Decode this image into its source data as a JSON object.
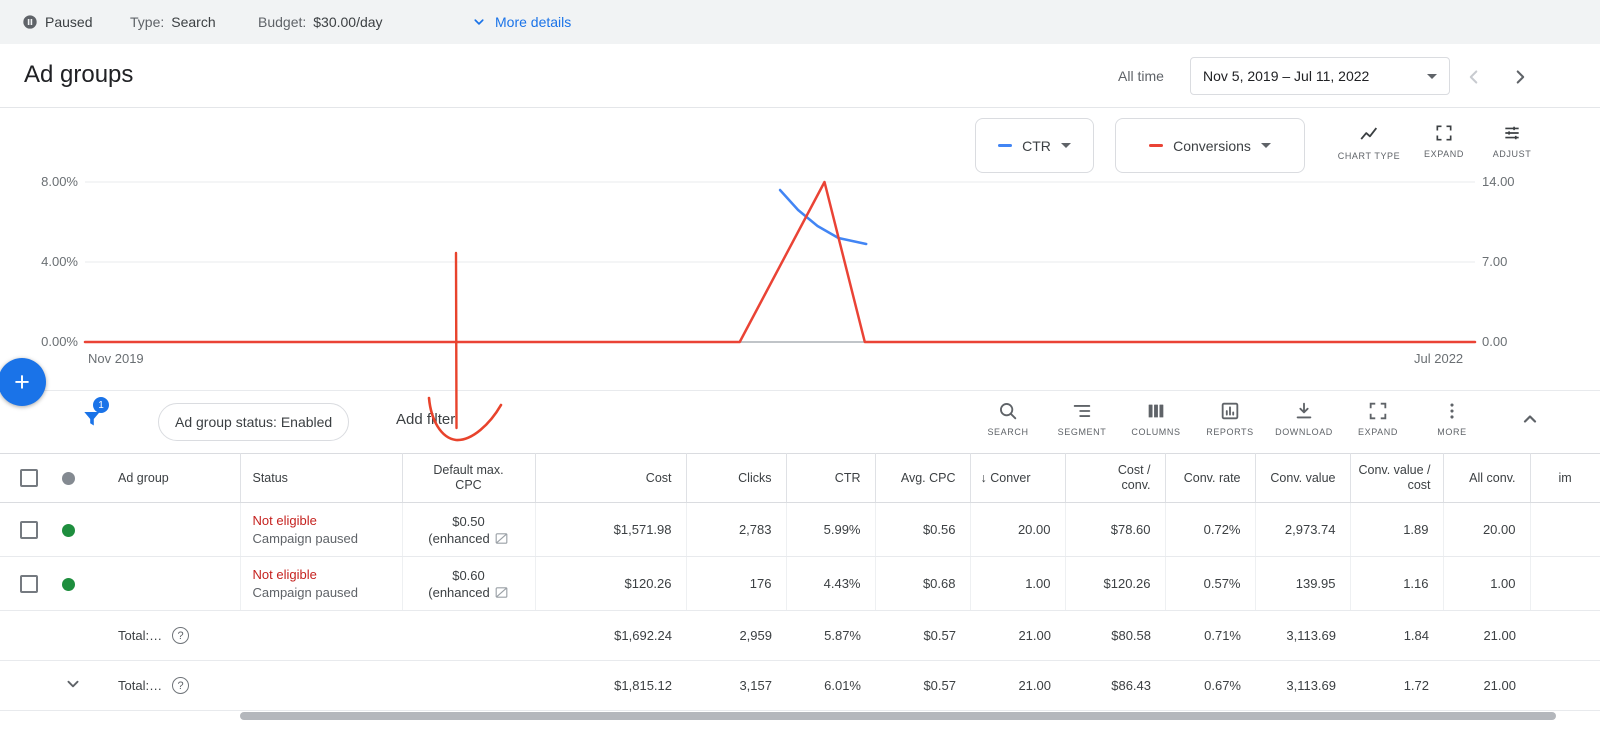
{
  "topbar": {
    "paused_label": "Paused",
    "type_label": "Type:",
    "type_value": "Search",
    "budget_label": "Budget:",
    "budget_value": "$30.00/day",
    "more_details_label": "More details"
  },
  "header": {
    "title": "Ad groups",
    "time_scope_label": "All time",
    "date_range": "Nov 5, 2019 – Jul 11, 2022"
  },
  "chart_controls": {
    "metric1_label": "CTR",
    "metric2_label": "Conversions",
    "chart_type_label": "CHART TYPE",
    "expand_label": "EXPAND",
    "adjust_label": "ADJUST"
  },
  "chart_data": {
    "type": "line",
    "legend": [
      "CTR",
      "Conversions"
    ],
    "legend_position": "top-right",
    "grid": "horizontal",
    "left_axis": {
      "max": 8,
      "ticks": [
        "8.00%",
        "4.00%",
        "0.00%"
      ]
    },
    "right_axis": {
      "max": 14,
      "ticks": [
        "14.00",
        "7.00",
        "0.00"
      ]
    },
    "x_axis": {
      "labels": [
        "Nov 2019",
        "Jul 2022"
      ]
    },
    "series": [
      {
        "name": "CTR",
        "color": "#4285f4",
        "axis": "left",
        "axis_max": 8,
        "points": [
          {
            "x": 0.5,
            "y": 7.6
          },
          {
            "x": 0.513,
            "y": 6.6
          },
          {
            "x": 0.527,
            "y": 5.8
          },
          {
            "x": 0.542,
            "y": 5.2
          },
          {
            "x": 0.562,
            "y": 4.9
          }
        ]
      },
      {
        "name": "Conversions",
        "color": "#ea4335",
        "axis": "right",
        "axis_max": 14,
        "points": [
          {
            "x": 0,
            "y": 0
          },
          {
            "x": 0.471,
            "y": 0
          },
          {
            "x": 0.532,
            "y": 14
          },
          {
            "x": 0.561,
            "y": 0
          },
          {
            "x": 1,
            "y": 0
          }
        ]
      }
    ]
  },
  "fab": {
    "plus_glyph": "+"
  },
  "filter_bar": {
    "badge_count": "1",
    "chip_label": "Ad group status: Enabled",
    "add_filter_label": "Add filter",
    "tools": [
      {
        "label": "SEARCH"
      },
      {
        "label": "SEGMENT"
      },
      {
        "label": "COLUMNS"
      },
      {
        "label": "REPORTS"
      },
      {
        "label": "DOWNLOAD"
      },
      {
        "label": "EXPAND"
      },
      {
        "label": "MORE"
      }
    ]
  },
  "table": {
    "headers": {
      "ad_group": "Ad group",
      "status": "Status",
      "default_max_cpc": "Default max. CPC",
      "cost": "Cost",
      "clicks": "Clicks",
      "ctr": "CTR",
      "avg_cpc": "Avg. CPC",
      "sort_arrow": "↓",
      "conversions": "Conver",
      "cost_per_conv": "Cost / conv.",
      "conv_rate": "Conv. rate",
      "conv_value": "Conv. value",
      "conv_value_per_cost": "Conv. value / cost",
      "all_conv": "All conv.",
      "impressions": "im"
    },
    "help_glyph": "?",
    "rows": [
      {
        "status_main": "Not eligible",
        "status_sub": "Campaign paused",
        "cpc_value": "$0.50",
        "cpc_qualifier": "(enhanced",
        "cost": "$1,571.98",
        "clicks": "2,783",
        "ctr": "5.99%",
        "avg_cpc": "$0.56",
        "conversions": "20.00",
        "cost_per_conv": "$78.60",
        "conv_rate": "0.72%",
        "conv_value": "2,973.74",
        "conv_value_per_cost": "1.89",
        "all_conv": "20.00"
      },
      {
        "status_main": "Not eligible",
        "status_sub": "Campaign paused",
        "cpc_value": "$0.60",
        "cpc_qualifier": "(enhanced",
        "cost": "$120.26",
        "clicks": "176",
        "ctr": "4.43%",
        "avg_cpc": "$0.68",
        "conversions": "1.00",
        "cost_per_conv": "$120.26",
        "conv_rate": "0.57%",
        "conv_value": "139.95",
        "conv_value_per_cost": "1.16",
        "all_conv": "1.00"
      }
    ],
    "totals": [
      {
        "label": "Total:…",
        "cost": "$1,692.24",
        "clicks": "2,959",
        "ctr": "5.87%",
        "avg_cpc": "$0.57",
        "conversions": "21.00",
        "cost_per_conv": "$80.58",
        "conv_rate": "0.71%",
        "conv_value": "3,113.69",
        "conv_value_per_cost": "1.84",
        "all_conv": "21.00"
      },
      {
        "label": "Total:…",
        "cost": "$1,815.12",
        "clicks": "3,157",
        "ctr": "6.01%",
        "avg_cpc": "$0.57",
        "conversions": "21.00",
        "cost_per_conv": "$86.43",
        "conv_rate": "0.67%",
        "conv_value": "3,113.69",
        "conv_value_per_cost": "1.72",
        "all_conv": "21.00"
      }
    ]
  },
  "colors": {
    "accent": "#1a73e8",
    "ctr_series": "#4285f4",
    "conversions_series": "#ea4335",
    "not_eligible_text": "#c5221f",
    "enabled_dot": "#1e8e3e",
    "annotation": "#e8432c"
  }
}
